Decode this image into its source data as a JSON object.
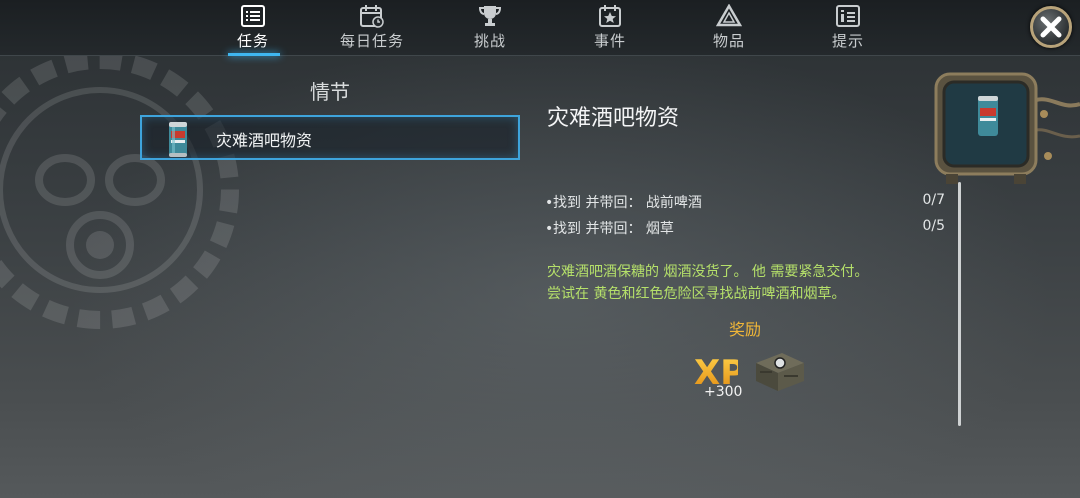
{
  "nav": {
    "tabs": [
      {
        "label": "任务",
        "icon": "list-icon",
        "active": true
      },
      {
        "label": "每日任务",
        "icon": "calendar-icon",
        "active": false
      },
      {
        "label": "挑战",
        "icon": "trophy-icon",
        "active": false
      },
      {
        "label": "事件",
        "icon": "star-calendar-icon",
        "active": false
      },
      {
        "label": "物品",
        "icon": "triangle-icon",
        "active": false
      },
      {
        "label": "提示",
        "icon": "info-list-icon",
        "active": false
      }
    ]
  },
  "left": {
    "section_title": "情节",
    "quests": [
      {
        "name": "灾难酒吧物资",
        "icon": "beer-can-icon",
        "selected": true
      }
    ]
  },
  "detail": {
    "title": "灾难酒吧物资",
    "objectives": [
      {
        "text": "找到 并带回： 战前啤酒",
        "count": "0/7"
      },
      {
        "text": "找到 并带回： 烟草",
        "count": "0/5"
      }
    ],
    "description_lines": [
      "灾难酒吧酒保糖的 烟酒没货了。 他 需要紧急交付。",
      "尝试在 黄色和红色危险区寻找战前啤酒和烟草。"
    ],
    "reward_title": "奖励",
    "rewards": {
      "xp_label": "XP",
      "xp_amount": "+300",
      "item_icon": "supply-crate-icon"
    }
  },
  "colors": {
    "accent": "#3ea4dc",
    "description": "#b5e06a",
    "reward": "#f0b638"
  }
}
